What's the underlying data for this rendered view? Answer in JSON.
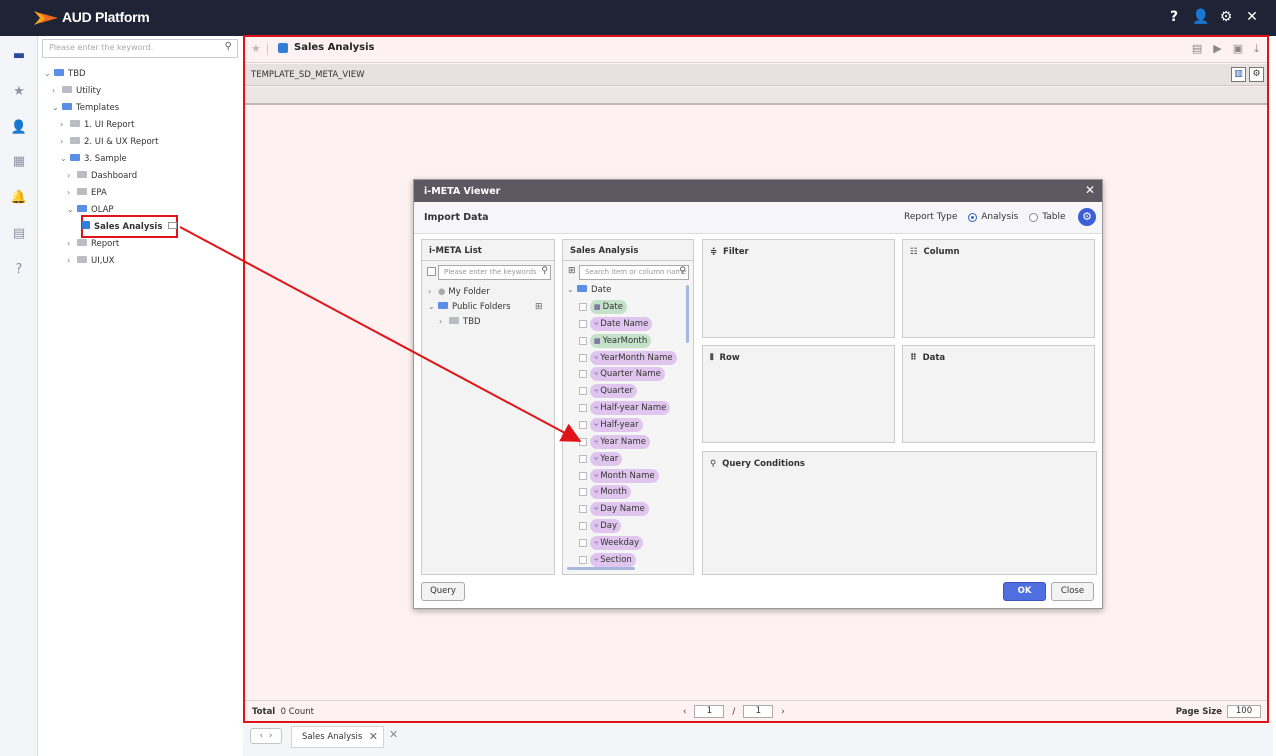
{
  "app": {
    "title": "AUD Platform"
  },
  "top_icons": [
    {
      "name": "help-icon",
      "glyph": "?"
    },
    {
      "name": "user-icon",
      "glyph": "👤"
    },
    {
      "name": "settings-icon",
      "glyph": "⚙"
    },
    {
      "name": "close-icon",
      "glyph": "✕"
    }
  ],
  "rail": [
    {
      "name": "folder-icon",
      "glyph": "▬"
    },
    {
      "name": "star-icon",
      "glyph": "★"
    },
    {
      "name": "person-icon",
      "glyph": "👤"
    },
    {
      "name": "dashboard-icon",
      "glyph": "▦"
    },
    {
      "name": "bell-icon",
      "glyph": "🔔"
    },
    {
      "name": "clipboard-icon",
      "glyph": "▤"
    },
    {
      "name": "help-icon",
      "glyph": "?"
    }
  ],
  "tree": {
    "search_placeholder": "Please enter the keyword.",
    "nodes": [
      {
        "label": "TBD",
        "caret": "⌄",
        "blue": true
      },
      {
        "label": "Utility",
        "caret": "›",
        "blue": false
      },
      {
        "label": "Templates",
        "caret": "⌄",
        "blue": true
      },
      {
        "label": "1. UI Report",
        "caret": "›",
        "blue": false
      },
      {
        "label": "2. UI & UX Report",
        "caret": "›",
        "blue": false
      },
      {
        "label": "3. Sample",
        "caret": "⌄",
        "blue": true
      },
      {
        "label": "Dashboard",
        "caret": "›",
        "blue": false
      },
      {
        "label": "EPA",
        "caret": "›",
        "blue": false
      },
      {
        "label": "OLAP",
        "caret": "⌄",
        "blue": true
      },
      {
        "label": "Sales Analysis",
        "caret": "",
        "blue": false,
        "selected": true
      },
      {
        "label": "Report",
        "caret": "›",
        "blue": false
      },
      {
        "label": "UI,UX",
        "caret": "›",
        "blue": false
      }
    ]
  },
  "main": {
    "tab_title": "Sales Analysis",
    "view_name": "TEMPLATE_SD_META_VIEW",
    "footer": {
      "total_label": "Total",
      "count": "0 Count",
      "page": "1",
      "page_sep": "/",
      "page_total": "1",
      "page_size_label": "Page Size",
      "page_size": "100"
    }
  },
  "bottom_tabs": [
    {
      "label": "Sales Analysis"
    }
  ],
  "dialog": {
    "title": "i-META Viewer",
    "header": "Import Data",
    "report_type_label": "Report Type",
    "options": [
      "Analysis",
      "Table"
    ],
    "selected_option": "Analysis",
    "meta_list": {
      "title": "i-META List",
      "search_placeholder": "Please enter the keywords",
      "items": [
        {
          "label": "My Folder",
          "caret": "›"
        },
        {
          "label": "Public Folders",
          "caret": "⌄"
        },
        {
          "label": "TBD",
          "caret": "›"
        }
      ]
    },
    "sales": {
      "title": "Sales Analysis",
      "search_placeholder": "Search item or column name",
      "folder": "Date",
      "items": [
        {
          "label": "Date",
          "kind": "date"
        },
        {
          "label": "Date Name",
          "kind": "dim"
        },
        {
          "label": "YearMonth",
          "kind": "date"
        },
        {
          "label": "YearMonth Name",
          "kind": "dim"
        },
        {
          "label": "Quarter Name",
          "kind": "dim"
        },
        {
          "label": "Quarter",
          "kind": "dim"
        },
        {
          "label": "Half-year Name",
          "kind": "dim"
        },
        {
          "label": "Half-year",
          "kind": "dim"
        },
        {
          "label": "Year Name",
          "kind": "dim"
        },
        {
          "label": "Year",
          "kind": "dim"
        },
        {
          "label": "Month Name",
          "kind": "dim"
        },
        {
          "label": "Month",
          "kind": "dim"
        },
        {
          "label": "Day Name",
          "kind": "dim"
        },
        {
          "label": "Day",
          "kind": "dim"
        },
        {
          "label": "Weekday",
          "kind": "dim"
        },
        {
          "label": "Section",
          "kind": "dim"
        }
      ]
    },
    "zones": {
      "filter": "Filter",
      "column": "Column",
      "row": "Row",
      "data": "Data",
      "query_conditions": "Query Conditions"
    },
    "buttons": {
      "query": "Query",
      "ok": "OK",
      "close": "Close"
    }
  },
  "colors": {
    "topbar": "#1f2336",
    "highlight": "#e01418",
    "primary": "#4f6fe0",
    "chip_dim": "#e0c6ee",
    "chip_date": "#c4e2c9"
  }
}
